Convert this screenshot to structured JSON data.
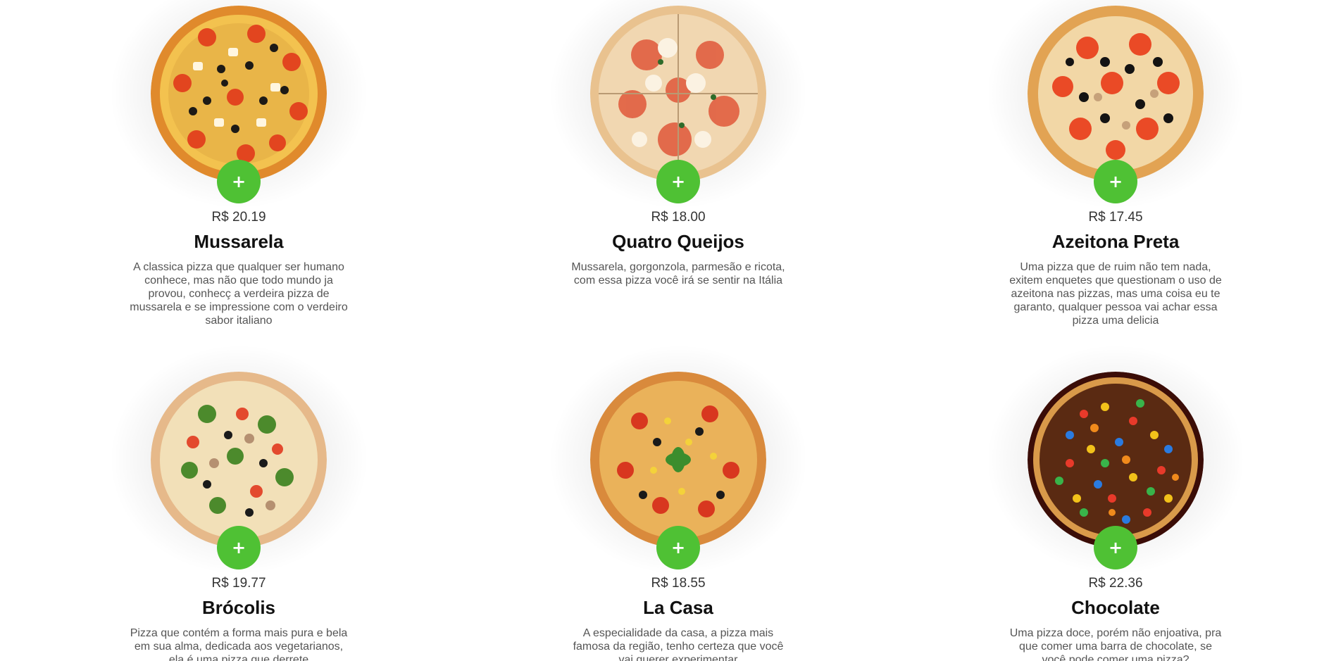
{
  "add_button_label": "+",
  "accent_color": "#4fc134",
  "products": [
    {
      "price": "R$ 20.19",
      "name": "Mussarela",
      "description": "A classica pizza que qualquer ser humano conhece, mas não que todo mundo ja provou, conhecç a verdeira pizza de mussarela e se impressione com o verdeiro sabor italiano"
    },
    {
      "price": "R$ 18.00",
      "name": "Quatro Queijos",
      "description": "Mussarela, gorgonzola, parmesão e ricota, com essa pizza você irá se sentir na Itália"
    },
    {
      "price": "R$ 17.45",
      "name": "Azeitona Preta",
      "description": "Uma pizza que de ruim não tem nada, exitem enquetes que questionam o uso de azeitona nas pizzas, mas uma coisa eu te garanto, qualquer pessoa vai achar essa pizza uma delicia"
    },
    {
      "price": "R$ 19.77",
      "name": "Brócolis",
      "description": "Pizza que contém a forma mais pura e bela em sua alma, dedicada aos vegetarianos, ela é uma pizza que derrete"
    },
    {
      "price": "R$ 18.55",
      "name": "La Casa",
      "description": "A especialidade da casa, a pizza mais famosa da região, tenho certeza que você vai querer experimentar"
    },
    {
      "price": "R$ 22.36",
      "name": "Chocolate",
      "description": "Uma pizza doce, porém não enjoativa, pra que comer uma barra de chocolate, se você pode comer uma pizza?"
    }
  ]
}
